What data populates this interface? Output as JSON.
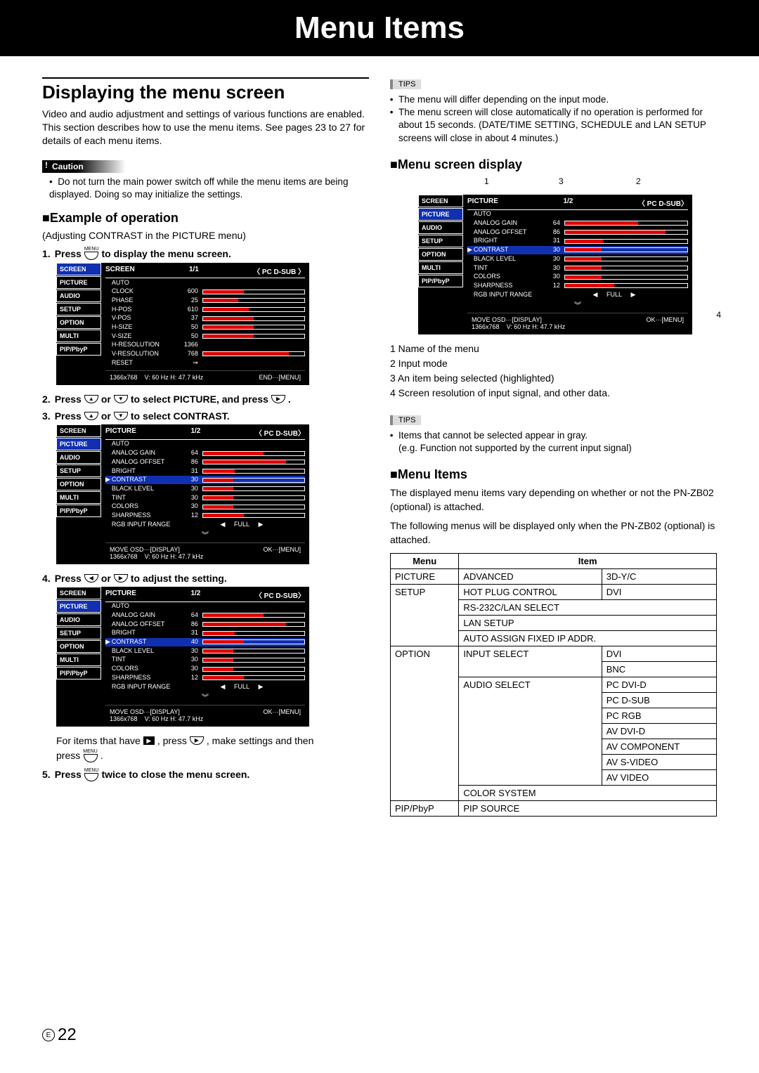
{
  "page": {
    "title": "Menu Items",
    "section_title": "Displaying the menu screen",
    "intro": "Video and audio adjustment and settings of various functions are enabled. This section describes how to use the menu items. See pages 23 to 27 for details of each menu items.",
    "caution_label": "Caution",
    "caution_text": "Do not turn the main power switch off while the menu items are being displayed. Doing so may initialize the settings.",
    "example_heading": "■Example of operation",
    "example_sub": "(Adjusting CONTRAST in the PICTURE menu)",
    "step1": "1.",
    "step1_text_a": "Press",
    "step1_text_b": "to display the menu screen.",
    "step2": "2.",
    "step2_text_a": "Press",
    "step2_text_b": "or",
    "step2_text_c": "to select PICTURE, and press",
    "step3": "3.",
    "step3_text_a": "Press",
    "step3_text_b": "or",
    "step3_text_c": "to select CONTRAST.",
    "step4": "4.",
    "step4_text_a": "Press",
    "step4_text_b": "or",
    "step4_text_c": "to adjust the setting.",
    "after4_a": "For items that have",
    "after4_b": ", press",
    "after4_c": ", make settings and then",
    "after4_d": "press",
    "step5": "5.",
    "step5_text_a": "Press",
    "step5_text_b": "twice to close the menu screen.",
    "menu_btn_tiny": "MENU",
    "page_number": "22",
    "page_circle": "E"
  },
  "osd_screen": {
    "tabs": [
      "SCREEN",
      "PICTURE",
      "AUDIO",
      "SETUP",
      "OPTION",
      "MULTI",
      "PIP/PbyP"
    ],
    "active": 0,
    "header_title": "SCREEN",
    "header_page": "1/1",
    "header_mode": "〈 PC D-SUB 〉",
    "rows": [
      {
        "label": "AUTO",
        "val": "",
        "bar": null
      },
      {
        "label": "CLOCK",
        "val": "600",
        "bar": 40
      },
      {
        "label": "PHASE",
        "val": "25",
        "bar": 35
      },
      {
        "label": "H-POS",
        "val": "610",
        "bar": 45
      },
      {
        "label": "V-POS",
        "val": "37",
        "bar": 50
      },
      {
        "label": "H-SIZE",
        "val": "50",
        "bar": 50
      },
      {
        "label": "V-SIZE",
        "val": "50",
        "bar": 50
      },
      {
        "label": "H-RESOLUTION",
        "val": "1366",
        "bar": null
      },
      {
        "label": "V-RESOLUTION",
        "val": "768",
        "bar": 85,
        "thin": true
      },
      {
        "label": "RESET",
        "val": "⇒",
        "bar": null
      }
    ],
    "footer_res": "1366x768",
    "footer_hz": "V: 60 Hz   H: 47.7 kHz",
    "footer_end": "END···[MENU]"
  },
  "osd_picture": {
    "tabs": [
      "SCREEN",
      "PICTURE",
      "AUDIO",
      "SETUP",
      "OPTION",
      "MULTI",
      "PIP/PbyP"
    ],
    "active": 1,
    "header_title": "PICTURE",
    "header_page": "1/2",
    "header_mode": "〈 PC D-SUB〉",
    "rows": [
      {
        "label": "AUTO",
        "val": "",
        "bar": null
      },
      {
        "label": "ANALOG GAIN",
        "val": "64",
        "bar": 60
      },
      {
        "label": "ANALOG OFFSET",
        "val": "86",
        "bar": 82
      },
      {
        "label": "BRIGHT",
        "val": "31",
        "bar": 31
      },
      {
        "label": "CONTRAST",
        "val": "30",
        "bar": 30,
        "sel": true,
        "pointer": true
      },
      {
        "label": "BLACK LEVEL",
        "val": "30",
        "bar": 30
      },
      {
        "label": "TINT",
        "val": "30",
        "bar": 30
      },
      {
        "label": "COLORS",
        "val": "30",
        "bar": 30
      },
      {
        "label": "SHARPNESS",
        "val": "12",
        "bar": 40
      },
      {
        "label": "RGB INPUT RANGE",
        "val": "",
        "bar": null,
        "full": "FULL",
        "arrows": true
      }
    ],
    "more": "︾",
    "footer_move": "MOVE OSD···[DISPLAY]",
    "footer_res": "1366x768",
    "footer_hz": "V: 60 Hz   H: 47.7 kHz",
    "footer_ok": "OK···[MENU]"
  },
  "osd_picture_adj": {
    "contrast_val": "40",
    "contrast_bar": 40
  },
  "right": {
    "tips_label": "TIPS",
    "tips1_a": "The menu will differ depending on the input mode.",
    "tips1_b": "The menu screen will close automatically if no operation is performed for about 15 seconds. (DATE/TIME SETTING, SCHEDULE and LAN SETUP screens will close in about 4 minutes.)",
    "menu_screen_heading": "■Menu screen display",
    "legend": {
      "l1": "1  Name of the menu",
      "l2": "2  Input mode",
      "l3": "3  An item being selected (highlighted)",
      "l4": "4  Screen resolution of input signal, and other data."
    },
    "tips2": "Items that cannot be selected appear in gray.\n(e.g. Function not supported by the current input signal)",
    "menu_items_heading": "■Menu Items",
    "menu_items_text1": "The displayed menu items vary depending on whether or not the PN-ZB02 (optional) is attached.",
    "menu_items_text2": "The following menus will be displayed only when the PN-ZB02 (optional) is attached.",
    "table": {
      "head": [
        "Menu",
        "Item"
      ],
      "rows": [
        [
          "PICTURE",
          "ADVANCED",
          "3D-Y/C"
        ],
        [
          "SETUP",
          "HOT PLUG CONTROL",
          "DVI"
        ],
        [
          "",
          "RS-232C/LAN SELECT",
          ""
        ],
        [
          "",
          "LAN SETUP",
          ""
        ],
        [
          "",
          "AUTO ASSIGN FIXED IP ADDR.",
          ""
        ],
        [
          "OPTION",
          "INPUT SELECT",
          "DVI"
        ],
        [
          "",
          "",
          "BNC"
        ],
        [
          "",
          "AUDIO SELECT",
          "PC DVI-D"
        ],
        [
          "",
          "",
          "PC D-SUB"
        ],
        [
          "",
          "",
          "PC RGB"
        ],
        [
          "",
          "",
          "AV DVI-D"
        ],
        [
          "",
          "",
          "AV COMPONENT"
        ],
        [
          "",
          "",
          "AV S-VIDEO"
        ],
        [
          "",
          "",
          "AV VIDEO"
        ],
        [
          "",
          "COLOR SYSTEM",
          ""
        ],
        [
          "PIP/PbyP",
          "PIP SOURCE",
          ""
        ]
      ]
    }
  }
}
